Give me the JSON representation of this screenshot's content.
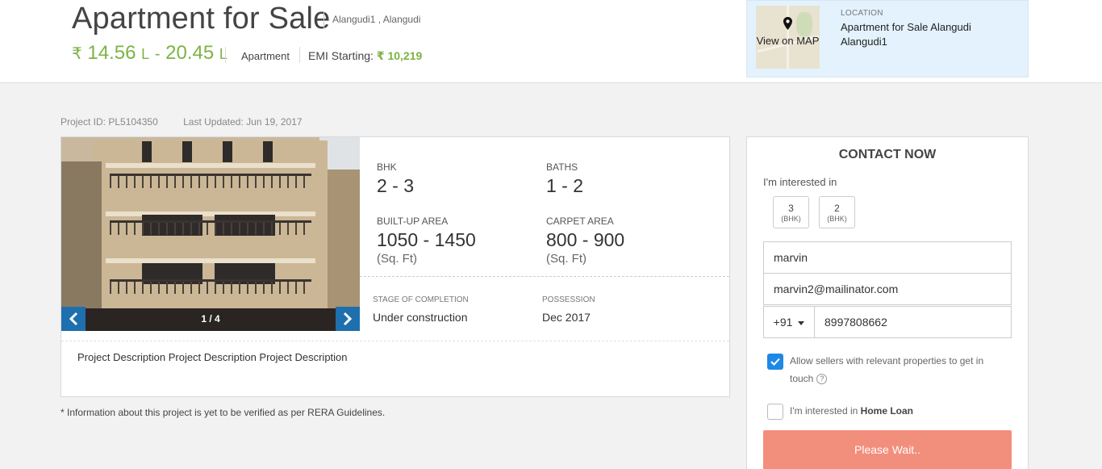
{
  "header": {
    "title": "Apartment for Sale",
    "location_short": "Alangudi1 , Alangudi",
    "price": {
      "currency": "₹",
      "min_value": "14.56",
      "min_unit": "L",
      "separator": "-",
      "max_value": "20.45",
      "max_unit": "L"
    },
    "property_type": "Apartment",
    "emi_label": "EMI Starting:",
    "emi_value": "₹ 10,219"
  },
  "location_box": {
    "map_label": "View on MAP",
    "heading": "LOCATION",
    "text": "Apartment for Sale Alangudi Alangudi1"
  },
  "meta": {
    "project_id": "Project ID: PL5104350",
    "last_updated": "Last Updated: Jun 19, 2017"
  },
  "gallery": {
    "counter": "1 / 4",
    "current": 1,
    "total": 4
  },
  "specs": {
    "bhk_label": "BHK",
    "bhk_value": "2 - 3",
    "baths_label": "BATHS",
    "baths_value": "1 - 2",
    "builtup_label": "BUILT-UP AREA",
    "builtup_value": "1050 - 1450",
    "builtup_unit": "(Sq. Ft)",
    "carpet_label": "CARPET AREA",
    "carpet_value": "800 - 900",
    "carpet_unit": "(Sq. Ft)",
    "stage_label": "STAGE OF COMPLETION",
    "stage_value": "Under construction",
    "possession_label": "POSSESSION",
    "possession_value": "Dec 2017"
  },
  "description": "Project Description Project Description Project Description",
  "rera_note": "* Information about this project is yet to be verified as per RERA Guidelines.",
  "contact": {
    "title": "CONTACT NOW",
    "interest_label": "I'm interested in",
    "bhk_options": [
      {
        "num": "3",
        "sub": "(BHK)"
      },
      {
        "num": "2",
        "sub": "(BHK)"
      }
    ],
    "name_value": "marvin",
    "email_value": "marvin2@mailinator.com",
    "phone_code": "+91",
    "phone_value": "8997808662",
    "allow_sellers_text": "Allow sellers with relevant properties to get in touch",
    "allow_sellers_checked": true,
    "home_loan_prefix": "I'm interested in",
    "home_loan_bold": "Home Loan",
    "home_loan_checked": false,
    "submit_label": "Please Wait.."
  },
  "colors": {
    "price_green": "#7cb342",
    "accent_blue": "#1e6fae",
    "checkbox_blue": "#1e88e5",
    "submit_salmon": "#f28e7c",
    "location_bg": "#e3f2fd"
  }
}
